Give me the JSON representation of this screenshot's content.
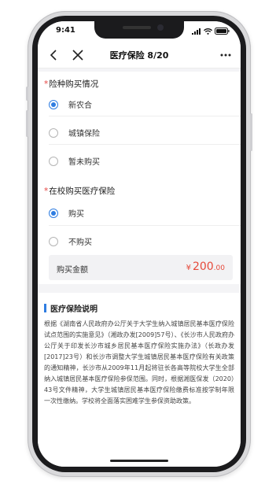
{
  "status_bar": {
    "time": "9:41"
  },
  "navbar": {
    "title": "医疗保险 8/20",
    "back_icon": "chevron-left-icon",
    "close_icon": "close-icon",
    "more_icon": "more-icon"
  },
  "questions": [
    {
      "required_mark": "*",
      "title": "险种购买情况",
      "options": [
        {
          "label": "新农合",
          "checked": true
        },
        {
          "label": "城镇保险",
          "checked": false
        },
        {
          "label": "暂未购买",
          "checked": false
        }
      ]
    },
    {
      "required_mark": "*",
      "title": "在校购买医疗保险",
      "options": [
        {
          "label": "购买",
          "checked": true
        },
        {
          "label": "不购买",
          "checked": false
        }
      ]
    }
  ],
  "amount": {
    "label": "购买金额",
    "currency": "¥",
    "integer": "200",
    "decimal": ".00"
  },
  "explanation": {
    "title": "医疗保险说明",
    "body": "根据《湖南省人民政府办公厅关于大学生纳入城镇居民基本医疗保险试点范围的实施意见》（湘政办发[2009]57号）、《长沙市人民政府办公厅关于印发长沙市城乡居民基本医疗保险实施办法》（长政办发[2017]23号）和长沙市调整大学生城镇居民基本医疗保险有关政策的通知精神，长沙市从2009年11月起将驻长各高等院校大学生全部纳入城镇居民基本医疗保险参保范围。同时，根据湘医保发（2020）43号文件精神，大学生城镇居民基本医疗保险缴费标准按学制年限一次性缴纳。学校将全面落实困难学生参保资助政策。"
  },
  "colors": {
    "accent": "#2f7de1",
    "price": "#e64a3b",
    "required": "#e64340"
  }
}
